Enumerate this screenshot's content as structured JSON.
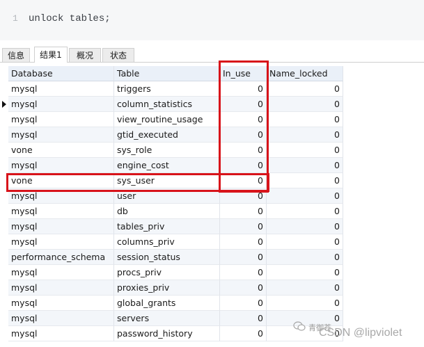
{
  "editor": {
    "line_number": "1",
    "code": "unlock tables;"
  },
  "tabs": [
    {
      "label": "信息"
    },
    {
      "label": "结果1"
    },
    {
      "label": "概况"
    },
    {
      "label": "状态"
    }
  ],
  "grid": {
    "headers": [
      "Database",
      "Table",
      "In_use",
      "Name_locked"
    ],
    "rows": [
      [
        "mysql",
        "triggers",
        "0",
        "0"
      ],
      [
        "mysql",
        "column_statistics",
        "0",
        "0"
      ],
      [
        "mysql",
        "view_routine_usage",
        "0",
        "0"
      ],
      [
        "mysql",
        "gtid_executed",
        "0",
        "0"
      ],
      [
        "vone",
        "sys_role",
        "0",
        "0"
      ],
      [
        "mysql",
        "engine_cost",
        "0",
        "0"
      ],
      [
        "vone",
        "sys_user",
        "0",
        "0"
      ],
      [
        "mysql",
        "user",
        "0",
        "0"
      ],
      [
        "mysql",
        "db",
        "0",
        "0"
      ],
      [
        "mysql",
        "tables_priv",
        "0",
        "0"
      ],
      [
        "mysql",
        "columns_priv",
        "0",
        "0"
      ],
      [
        "performance_schema",
        "session_status",
        "0",
        "0"
      ],
      [
        "mysql",
        "procs_priv",
        "0",
        "0"
      ],
      [
        "mysql",
        "proxies_priv",
        "0",
        "0"
      ],
      [
        "mysql",
        "global_grants",
        "0",
        "0"
      ],
      [
        "mysql",
        "servers",
        "0",
        "0"
      ],
      [
        "mysql",
        "password_history",
        "0",
        "0"
      ]
    ]
  },
  "watermark": {
    "account": "青御苍",
    "text": "CSDN @lipviolet"
  },
  "colors": {
    "highlight": "#d8131a",
    "header_bg": "#eaf0f8",
    "editor_bg": "#f6f7f8"
  }
}
